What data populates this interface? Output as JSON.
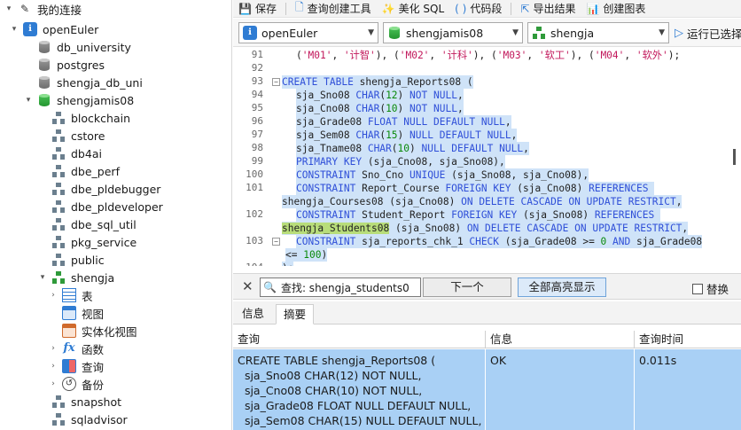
{
  "tree": {
    "root_label": "我的连接",
    "connection": "openEuler",
    "databases": [
      "db_university",
      "postgres",
      "shengja_db_uni",
      "shengjamis08"
    ],
    "schemas": [
      "blockchain",
      "cstore",
      "db4ai",
      "dbe_perf",
      "dbe_pldebugger",
      "dbe_pldeveloper",
      "dbe_sql_util",
      "pkg_service",
      "public",
      "shengja"
    ],
    "schema_children": [
      "表",
      "视图",
      "实体化视图",
      "函数",
      "查询",
      "备份"
    ],
    "after_schemas": [
      "snapshot",
      "sqladvisor"
    ]
  },
  "toolbar": {
    "save": "保存",
    "query_builder": "查询创建工具",
    "beautify": "美化 SQL",
    "code_snippet": "代码段",
    "export": "导出结果",
    "create_chart": "创建图表"
  },
  "selectors": {
    "connection": "openEuler",
    "database": "shengjamis08",
    "schema": "shengja",
    "run": "运行已选择的"
  },
  "editor": {
    "lines": [
      {
        "n": "91",
        "text": "('M01', '计智'), ('M02', '计科'), ('M03', '软工'), ('M04', '软外');"
      },
      {
        "n": "92",
        "text": ""
      },
      {
        "n": "93",
        "text": "CREATE TABLE shengja_Reports08 ("
      },
      {
        "n": "94",
        "text": "sja_Sno08 CHAR(12) NOT NULL,"
      },
      {
        "n": "95",
        "text": "sja_Cno08 CHAR(10) NOT NULL,"
      },
      {
        "n": "96",
        "text": "sja_Grade08 FLOAT NULL DEFAULT NULL,"
      },
      {
        "n": "97",
        "text": "sja_Sem08 CHAR(15) NULL DEFAULT NULL,"
      },
      {
        "n": "98",
        "text": "sja_Tname08 CHAR(10) NULL DEFAULT NULL,"
      },
      {
        "n": "99",
        "text": "PRIMARY KEY (sja_Cno08, sja_Sno08),"
      },
      {
        "n": "100",
        "text": "CONSTRAINT Sno_Cno UNIQUE (sja_Sno08, sja_Cno08),"
      },
      {
        "n": "101",
        "text": "CONSTRAINT Report_Course FOREIGN KEY (sja_Cno08) REFERENCES shengja_Courses08 (sja_Cno08) ON DELETE CASCADE ON UPDATE RESTRICT,"
      },
      {
        "n": "102",
        "text": "CONSTRAINT Student_Report FOREIGN KEY (sja_Sno08) REFERENCES shengja_Students08 (sja_Sno08) ON DELETE CASCADE ON UPDATE RESTRICT,"
      },
      {
        "n": "103",
        "text": "CONSTRAINT sja_reports_chk_1 CHECK (sja_Grade08 >= 0 AND sja_Grade08 <= 100)"
      },
      {
        "n": "104",
        "text": ");"
      }
    ]
  },
  "find": {
    "query": "查找: shengja_students0",
    "next": "下一个",
    "highlight_all": "全部高亮显示",
    "replace": "替换"
  },
  "result_tabs": [
    "信息",
    "摘要"
  ],
  "grid": {
    "headers": [
      "查询",
      "信息",
      "查询时间"
    ],
    "row": {
      "query_lines": [
        "CREATE TABLE shengja_Reports08 (",
        "  sja_Sno08 CHAR(12) NOT NULL,",
        "  sja_Cno08 CHAR(10) NOT NULL,",
        "  sja_Grade08 FLOAT NULL DEFAULT NULL,",
        "  sja_Sem08 CHAR(15) NULL DEFAULT NULL,"
      ],
      "info": "OK",
      "time": "0.011s"
    }
  },
  "colors": {
    "keyword": "#2f4fd8",
    "number": "#0a8a0a",
    "string": "#c2185b",
    "selection": "#cfe3f8",
    "find_match": "#b8dd7a",
    "result_row": "#a9d0f5"
  }
}
